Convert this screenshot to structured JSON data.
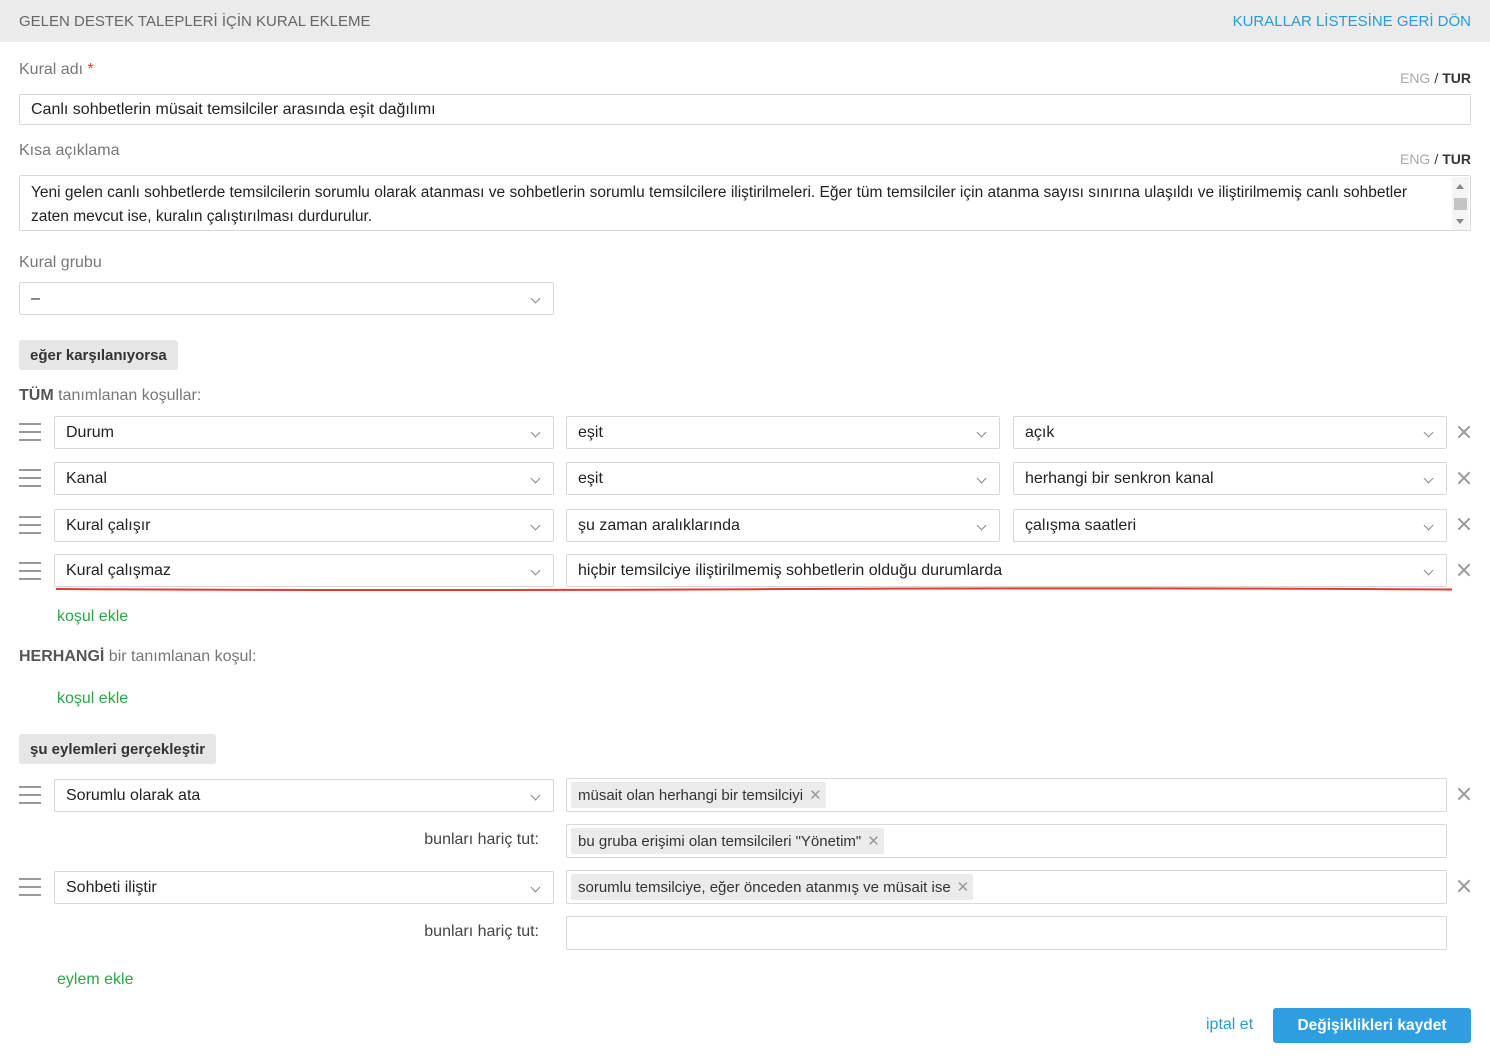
{
  "header": {
    "title": "GELEN DESTEK TALEPLERİ İÇİN KURAL EKLEME",
    "back_link": "KURALLAR LİSTESİNE GERİ DÖN"
  },
  "form": {
    "name_label": "Kural adı",
    "required_mark": "*",
    "name_value": "Canlı sohbetlerin müsait temsilciler arasında eşit dağılımı",
    "lang_eng": "ENG",
    "lang_sep": "/",
    "lang_tur": "TUR",
    "desc_label": "Kısa açıklama",
    "desc_value": "Yeni gelen canlı sohbetlerde temsilcilerin sorumlu olarak atanması ve sohbetlerin sorumlu temsilcilere iliştirilmeleri. Eğer tüm temsilciler için atanma sayısı sınırına ulaşıldı ve iliştirilmemiş canlı sohbetler zaten mevcut ise, kuralın çalıştırılması durdurulur.",
    "group_label": "Kural grubu",
    "group_value": "–"
  },
  "conditions": {
    "section_button": "eğer karşılanıyorsa",
    "all_bold": "TÜM",
    "all_rest": "tanımlanan koşullar:",
    "rows": [
      {
        "field": "Durum",
        "operator": "eşit",
        "value": "açık"
      },
      {
        "field": "Kanal",
        "operator": "eşit",
        "value": "herhangi bir senkron kanal"
      },
      {
        "field": "Kural çalışır",
        "operator": "şu zaman aralıklarında",
        "value": "çalışma saatleri"
      },
      {
        "field": "Kural çalışmaz",
        "operator": "hiçbir temsilciye iliştirilmemiş sohbetlerin olduğu durumlarda"
      }
    ],
    "add_all": "koşul ekle",
    "any_bold": "HERHANGİ",
    "any_rest": "bir tanımlanan koşul:",
    "add_any": "koşul ekle"
  },
  "actions": {
    "section_button": "şu eylemleri gerçekleştir",
    "rows": [
      {
        "action": "Sorumlu olarak ata",
        "tags": [
          "müsait olan herhangi bir temsilciyi"
        ],
        "exclude_label": "bunları hariç tut:",
        "exclude_tags": [
          "bu gruba erişimi olan temsilcileri \"Yönetim\""
        ]
      },
      {
        "action": "Sohbeti iliştir",
        "tags": [
          "sorumlu temsilciye, eğer önceden atanmış ve müsait ise"
        ],
        "exclude_label": "bunları hariç tut:",
        "exclude_tags": []
      }
    ],
    "add_action": "eylem ekle"
  },
  "footer": {
    "cancel": "iptal et",
    "save": "Değişiklikleri kaydet"
  },
  "colors": {
    "link_blue": "#2a9bd6",
    "add_green": "#27a844",
    "save_blue": "#2e9ee0",
    "annotation_red": "#e53935"
  }
}
